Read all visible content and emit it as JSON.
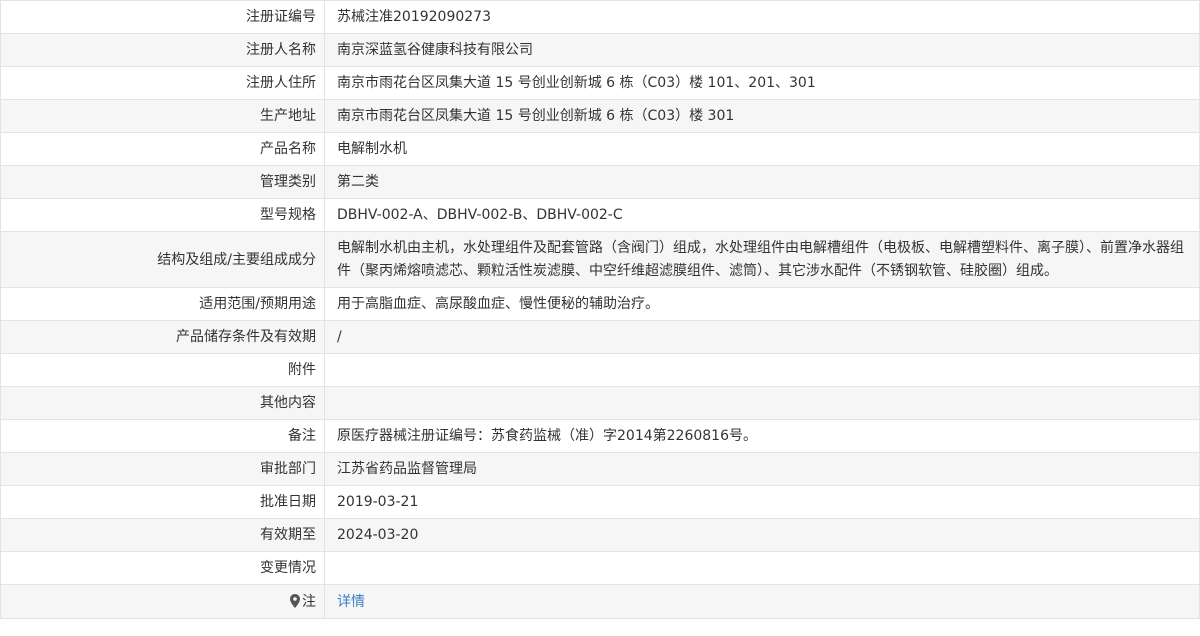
{
  "rows": [
    {
      "label": "注册证编号",
      "value": "苏械注准20192090273"
    },
    {
      "label": "注册人名称",
      "value": "南京深蓝氢谷健康科技有限公司"
    },
    {
      "label": "注册人住所",
      "value": "南京市雨花台区凤集大道 15 号创业创新城 6 栋（C03）楼 101、201、301"
    },
    {
      "label": "生产地址",
      "value": "南京市雨花台区凤集大道 15 号创业创新城 6 栋（C03）楼 301"
    },
    {
      "label": "产品名称",
      "value": "电解制水机"
    },
    {
      "label": "管理类别",
      "value": "第二类"
    },
    {
      "label": "型号规格",
      "value": "DBHV-002-A、DBHV-002-B、DBHV-002-C"
    },
    {
      "label": "结构及组成/主要组成成分",
      "value": "电解制水机由主机，水处理组件及配套管路（含阀门）组成，水处理组件由电解槽组件（电极板、电解槽塑料件、离子膜）、前置净水器组件（聚丙烯熔喷滤芯、颗粒活性炭滤膜、中空纤维超滤膜组件、滤筒）、其它涉水配件（不锈钢软管、硅胶圈）组成。"
    },
    {
      "label": "适用范围/预期用途",
      "value": "用于高脂血症、高尿酸血症、慢性便秘的辅助治疗。"
    },
    {
      "label": "产品储存条件及有效期",
      "value": "/"
    },
    {
      "label": "附件",
      "value": ""
    },
    {
      "label": "其他内容",
      "value": ""
    },
    {
      "label": "备注",
      "value": "原医疗器械注册证编号：苏食药监械（准）字2014第2260816号。"
    },
    {
      "label": "审批部门",
      "value": "江苏省药品监督管理局"
    },
    {
      "label": "批准日期",
      "value": "2019-03-21"
    },
    {
      "label": "有效期至",
      "value": "2024-03-20"
    },
    {
      "label": "变更情况",
      "value": ""
    }
  ],
  "note_row": {
    "label": "注",
    "icon": "map-pin-icon",
    "link_text": "详情",
    "link_color": "#3a7fc4"
  },
  "colors": {
    "border": "#e3e3e3",
    "alt_row_background": "#f6f6f6",
    "text": "#333333"
  }
}
